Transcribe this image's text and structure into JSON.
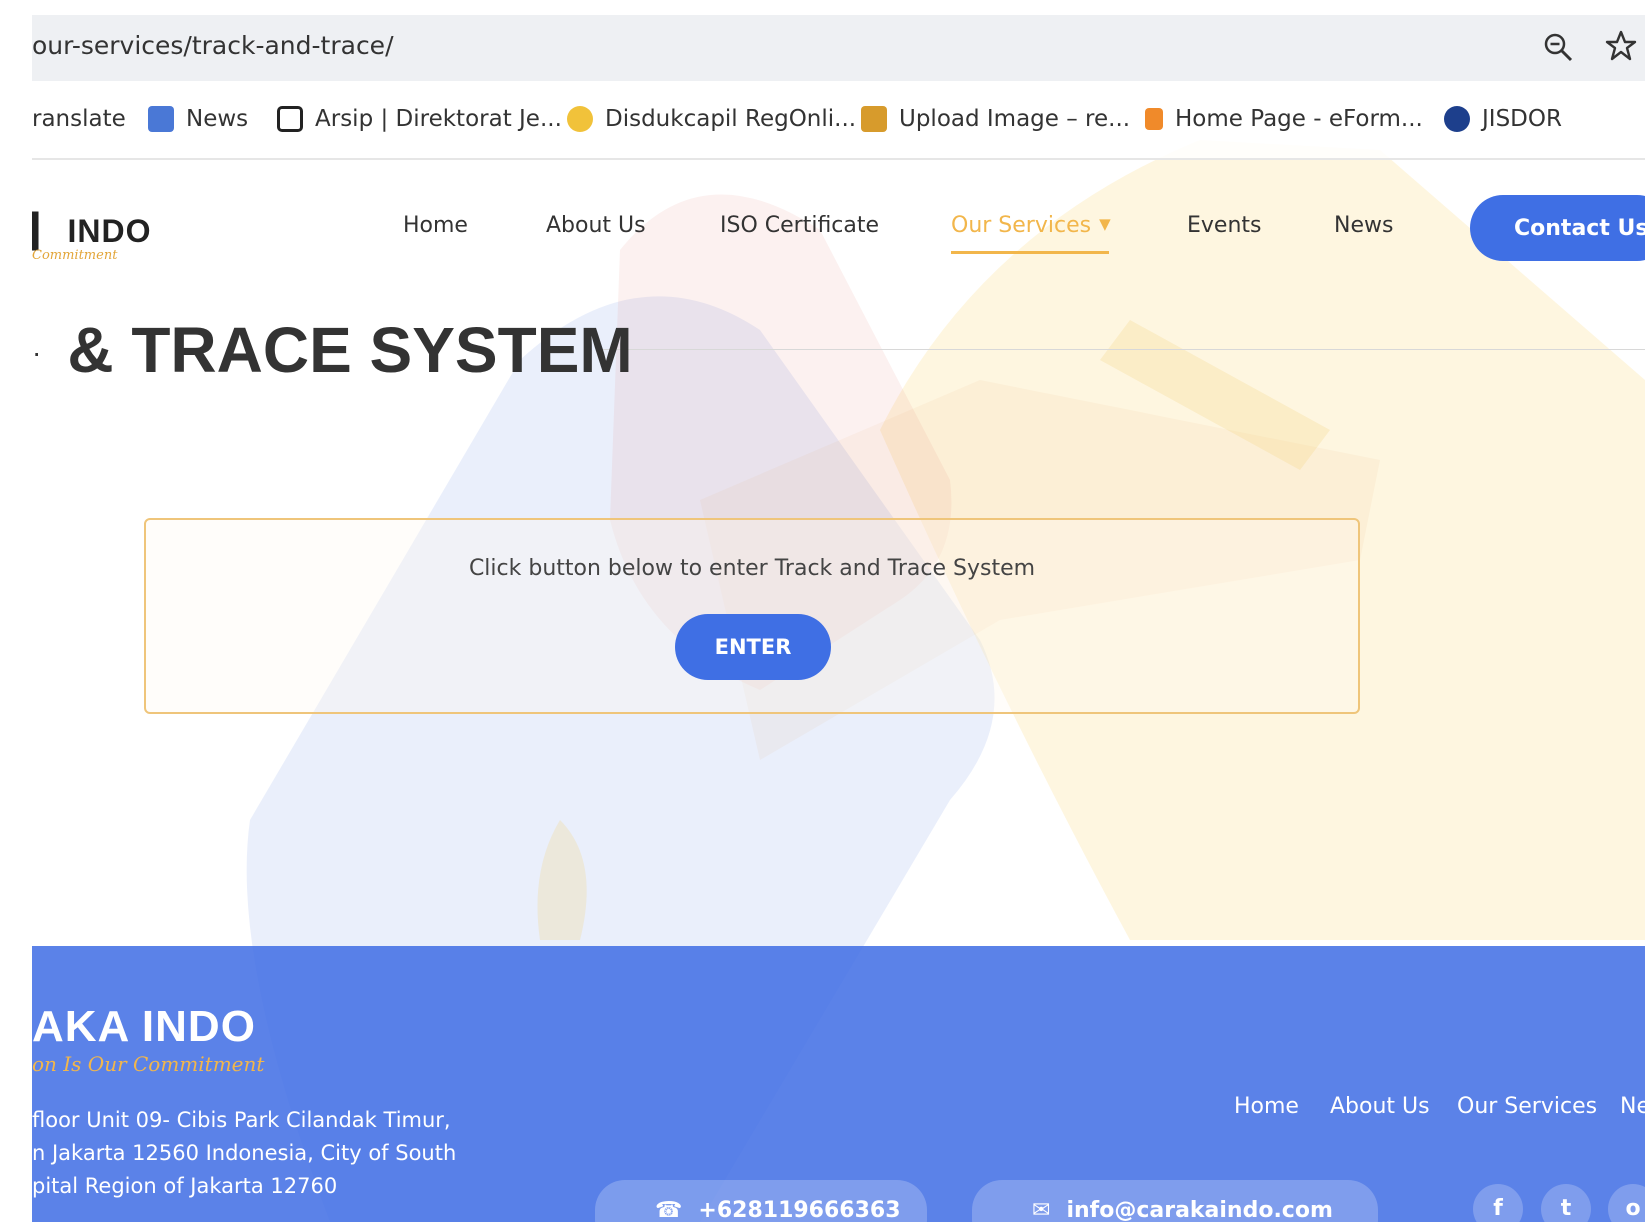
{
  "browser": {
    "url": "our-services/track-and-trace/",
    "bookmarks": [
      {
        "label": "ranslate",
        "icon": "translate-icon"
      },
      {
        "label": "News",
        "icon": "news-icon"
      },
      {
        "label": "Arsip | Direktorat Je...",
        "icon": "archive-icon"
      },
      {
        "label": "Disdukcapil RegOnli...",
        "icon": "shield-icon"
      },
      {
        "label": "Upload Image – re...",
        "icon": "upload-icon"
      },
      {
        "label": "Home Page - eForm...",
        "icon": "form-icon"
      },
      {
        "label": "JISDOR",
        "icon": "bank-icon"
      }
    ]
  },
  "header": {
    "logo_text": "▎ INDO",
    "logo_tagline": "Commitment",
    "nav": [
      "Home",
      "About Us",
      "ISO Certificate",
      "Our Services",
      "Events",
      "News"
    ],
    "active_nav": "Our Services",
    "contact_label": "Contact Us"
  },
  "main": {
    "title": "& TRACE SYSTEM",
    "instruction": "Click button below to enter Track and Trace System",
    "enter_label": "ENTER"
  },
  "footer": {
    "logo_text": "AKA INDO",
    "logo_tagline": "on Is Our Commitment",
    "address_lines": [
      "floor Unit 09- Cibis Park Cilandak Timur,",
      "n Jakarta 12560 Indonesia, City of South",
      "pital Region of Jakarta 12760"
    ],
    "links": [
      "Home",
      "About Us",
      "Our Services",
      "Ne"
    ],
    "phone": "+628119666363",
    "email": "info@carakaindo.com",
    "social": [
      "f",
      "t",
      "o"
    ]
  },
  "colors": {
    "accent_blue": "#3f6fe4",
    "accent_gold": "#f2b64b",
    "footer_blue": "#406ee4"
  }
}
